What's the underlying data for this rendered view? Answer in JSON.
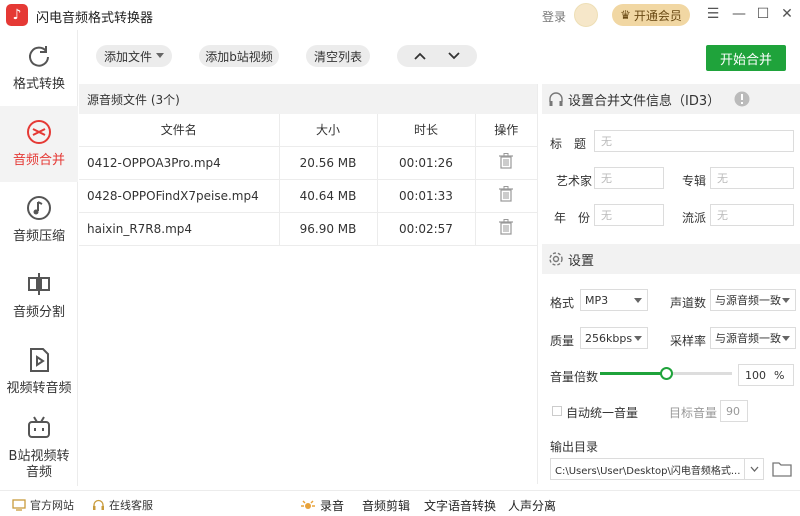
{
  "app": {
    "title": "闪电音频格式转换器",
    "login": "登录",
    "vip_label": "开通会员"
  },
  "sidebar": {
    "items": [
      {
        "label": "格式转换",
        "icon": "refresh-icon"
      },
      {
        "label": "音频合并",
        "icon": "merge-icon"
      },
      {
        "label": "音频压缩",
        "icon": "music-note-icon"
      },
      {
        "label": "音频分割",
        "icon": "split-icon"
      },
      {
        "label": "视频转音频",
        "icon": "video-play-icon"
      },
      {
        "label": "B站视频转音频",
        "icon": "bilibili-icon"
      }
    ]
  },
  "toolbar": {
    "add_file": "添加文件",
    "add_bilibili": "添加b站视频",
    "clear_list": "清空列表",
    "start": "开始合并"
  },
  "file_list": {
    "header": "源音频文件 (3个)",
    "columns": [
      "文件名",
      "大小",
      "时长",
      "操作"
    ],
    "rows": [
      {
        "name": "0412-OPPOA3Pro.mp4",
        "size": "20.56 MB",
        "duration": "00:01:26"
      },
      {
        "name": "0428-OPPOFindX7peise.mp4",
        "size": "40.64 MB",
        "duration": "00:01:33"
      },
      {
        "name": "haixin_R7R8.mp4",
        "size": "96.90 MB",
        "duration": "00:02:57"
      }
    ]
  },
  "id3": {
    "header": "设置合并文件信息（ID3）",
    "title_label": "标　题",
    "artist_label": "艺术家",
    "album_label": "专辑",
    "year_label": "年　份",
    "genre_label": "流派",
    "placeholder": "无"
  },
  "settings": {
    "header": "设置",
    "format_label": "格式",
    "format_value": "MP3",
    "channels_label": "声道数",
    "channels_value": "与源音频一致",
    "quality_label": "质量",
    "quality_value": "256kbps",
    "samplerate_label": "采样率",
    "samplerate_value": "与源音频一致",
    "volume_label": "音量倍数",
    "volume_value": "100",
    "volume_unit": "%",
    "volume_level": 0.5,
    "auto_volume_label": "自动统一音量",
    "target_volume_label": "目标音量",
    "target_volume_value": "90",
    "output_label": "输出目录",
    "output_path": "C:\\Users\\User\\Desktop\\闪电音频格式..."
  },
  "bottom": {
    "website": "官方网站",
    "support": "在线客服",
    "tools": [
      "录音",
      "音频剪辑",
      "文字语音转换",
      "人声分离"
    ]
  },
  "colors": {
    "accent": "#e53935",
    "green": "#1fa33b",
    "vip": "#f1d7a3"
  }
}
